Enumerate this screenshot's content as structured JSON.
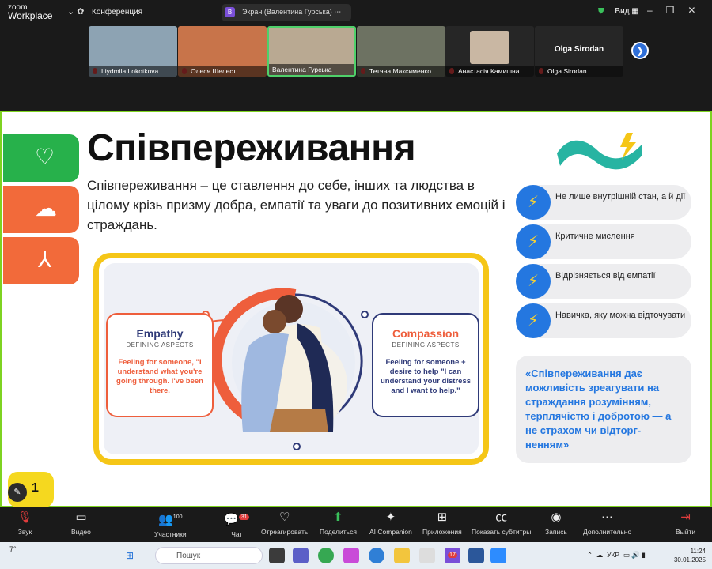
{
  "app": {
    "logo_top": "zoom",
    "logo_bottom": "Workplace",
    "conference": "Конференция",
    "screen_share": "Экран (Валентина Гурська)",
    "view": "Вид",
    "avatar_letter": "В"
  },
  "participants": [
    {
      "name": "Liydmila Lokotkova",
      "bg": "#8da3b3"
    },
    {
      "name": "Олеся Шелест",
      "bg": "#c8744a"
    },
    {
      "name": "Валентина Гурська",
      "bg": "#b9a992"
    },
    {
      "name": "Тетяна Максименко",
      "bg": "#6d7262"
    },
    {
      "name": "Анастасія Камишна",
      "bg": "#262626"
    },
    {
      "name": "Olga Sirodan",
      "bg": "#262626",
      "label": "Olga Sirodan"
    }
  ],
  "slide": {
    "title": "Співпереживання",
    "desc": "Співпереживання – це ставлення до себе, інших та людства в цілому крізь призму добра, емпатії та уваги до позитивних емоцій і страждань.",
    "pills": [
      "Не лише внутрішній стан, а й дії",
      "Критичне мислення",
      "Відрізняється від емпатії",
      "Навичка, яку можна відточувати"
    ],
    "quote": "«Співпереживання дає можливість зреагувати на страждання розумінням, терплячістю і добротою — а не страхом чи відторг-ненням»",
    "empathy": {
      "title": "Empathy",
      "sub": "DEFINING ASPECTS",
      "body": "Feeling for someone, \"I understand what you're going through. I've been there."
    },
    "compassion": {
      "title": "Compassion",
      "sub": "DEFINING ASPECTS",
      "body": "Feeling for someone + desire to help \"I can understand your distress and I want to help.\""
    },
    "page": "1"
  },
  "bottom": {
    "mic": "Звук",
    "video": "Видео",
    "participants": "Участники",
    "participants_count": "100",
    "chat": "Чат",
    "chat_badge": "31",
    "react": "Отреагировать",
    "share": "Поделиться",
    "ai": "AI Companion",
    "apps": "Приложения",
    "captions": "Показать субтитры",
    "record": "Запись",
    "more": "Дополнительно",
    "leave": "Выйти"
  },
  "taskbar": {
    "weather": "7°",
    "search": "Пошук",
    "lang": "УКР",
    "time": "11:24",
    "date": "30.01.2025",
    "badge": "17"
  },
  "colors": {
    "accent_green": "#7ed321",
    "tab_green": "#27b14b",
    "tab_orange": "#f26a3a",
    "blue": "#2477e0",
    "yellow": "#f5c617"
  }
}
